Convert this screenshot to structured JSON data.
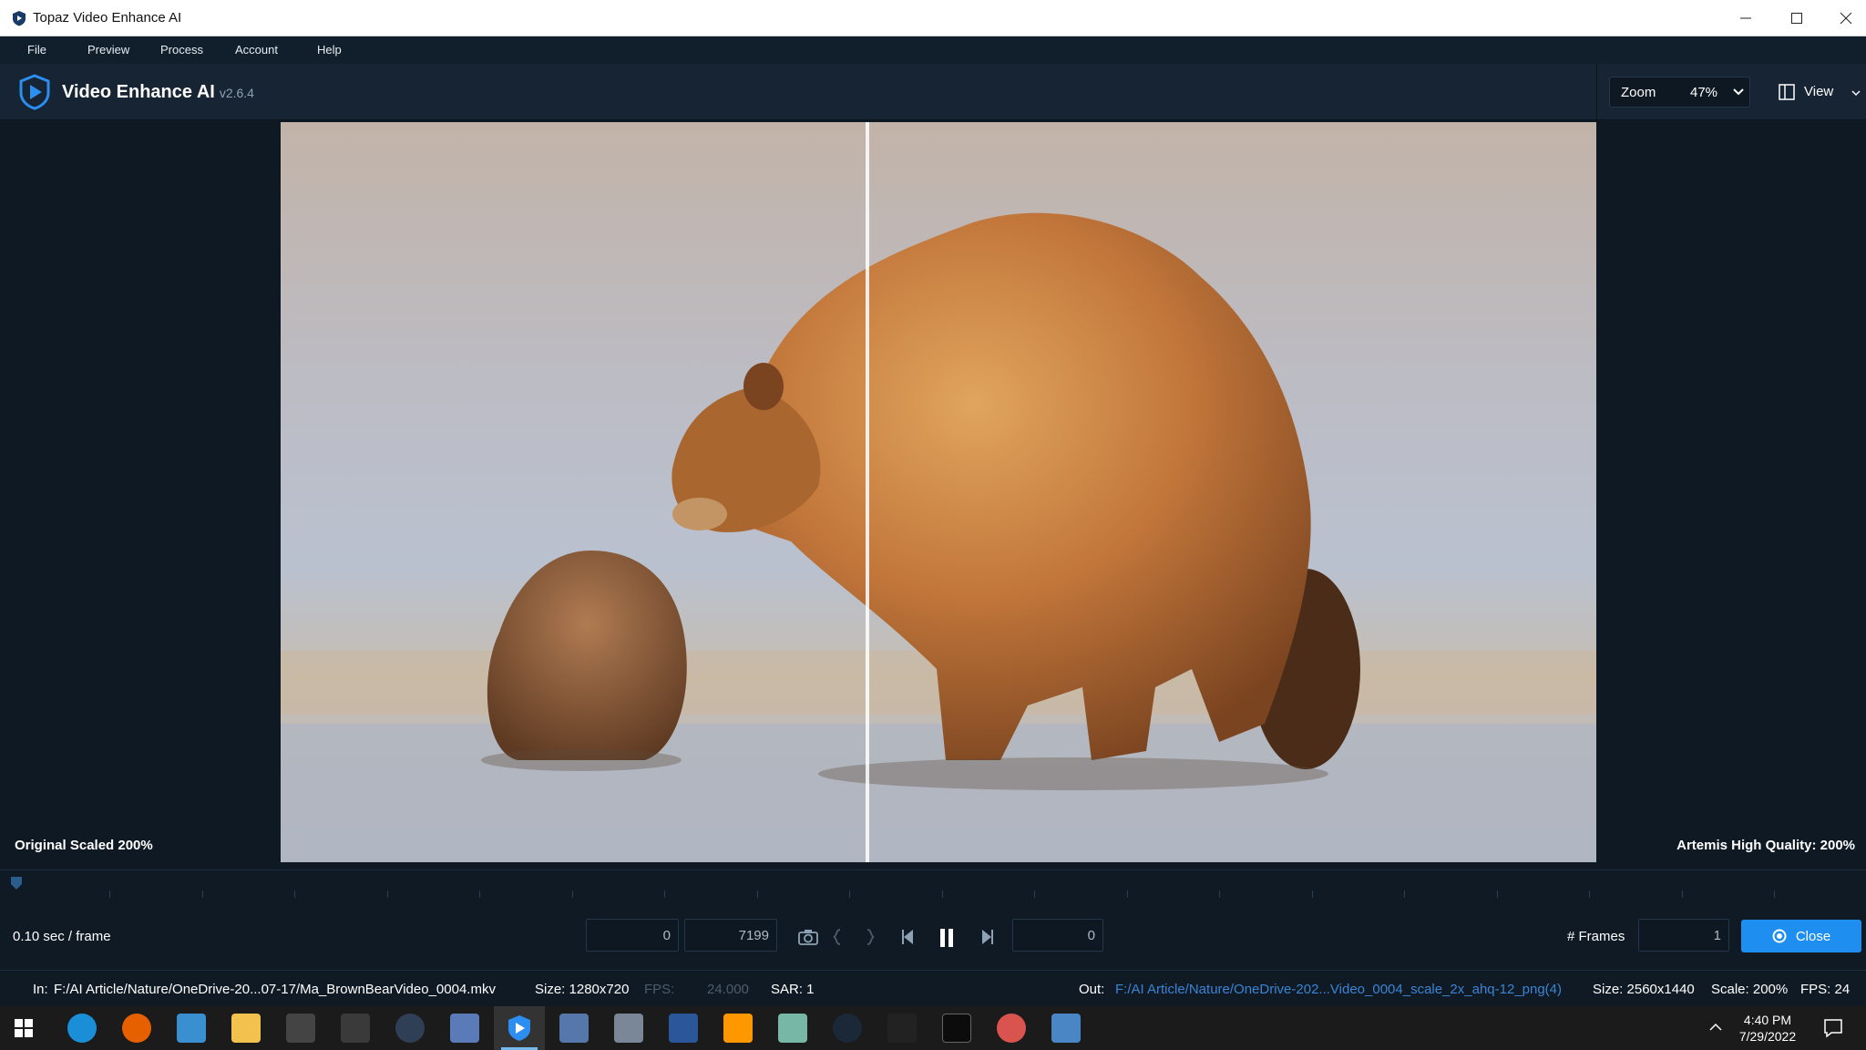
{
  "window": {
    "title": "Topaz Video Enhance AI"
  },
  "menu": {
    "items": [
      "File",
      "Preview",
      "Process",
      "Account",
      "Help"
    ]
  },
  "header": {
    "app_name": "Video Enhance AI",
    "version": "v2.6.4",
    "zoom_label": "Zoom",
    "zoom_value": "47%",
    "view_label": "View"
  },
  "viewer": {
    "left_label": "Original Scaled 200%",
    "right_label": "Artemis High Quality: 200%"
  },
  "controls": {
    "speed": "0.10 sec / frame",
    "start_frame": "0",
    "end_frame": "7199",
    "current_frame": "0",
    "frames_label": "# Frames",
    "frames_value": "1",
    "close_label": "Close"
  },
  "status": {
    "in_label": "In:",
    "in_path": "F:/AI Article/Nature/OneDrive-20...07-17/Ma_BrownBearVideo_0004.mkv",
    "in_size": "Size: 1280x720",
    "fps_label": "FPS:",
    "fps_value": "24.000",
    "sar": "SAR: 1",
    "out_label": "Out:",
    "out_path": "F:/AI Article/Nature/OneDrive-202...Video_0004_scale_2x_ahq-12_png(4)",
    "out_size": "Size: 2560x1440",
    "scale": "Scale: 200%",
    "out_fps": "FPS: 24"
  },
  "taskbar": {
    "time": "4:40 PM",
    "date": "7/29/2022",
    "icons": [
      "windows-start-icon",
      "edge-icon",
      "firefox-icon",
      "control-panel-icon",
      "file-explorer-icon",
      "video-editor-icon",
      "clapperboard-icon",
      "davinci-resolve-icon",
      "calculator-icon",
      "topaz-icon",
      "paint-icon",
      "printer-icon",
      "word-icon",
      "sublime-icon",
      "notepad-icon",
      "steam-icon",
      "audio-icon",
      "terminal-icon",
      "pinwheel-icon",
      "photos-icon"
    ]
  },
  "colors": {
    "accent": "#1e8ff0",
    "background": "#0f1a25",
    "header": "#162433"
  }
}
